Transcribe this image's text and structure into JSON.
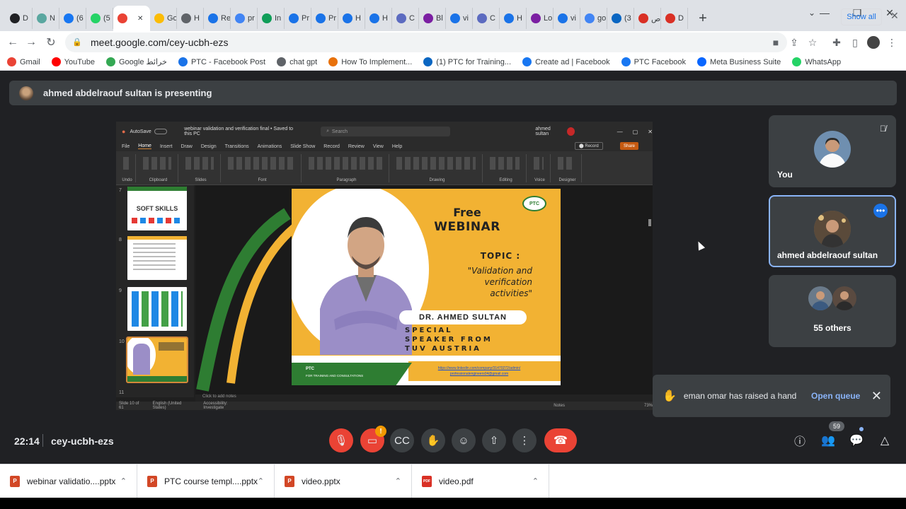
{
  "browser": {
    "tabs": [
      {
        "label": "D",
        "color": "#202124"
      },
      {
        "label": "N",
        "color": "#5aa7a0"
      },
      {
        "label": "(6",
        "color": "#1877f2"
      },
      {
        "label": "(5",
        "color": "#25d366"
      },
      {
        "label": "",
        "color": "#ea4335"
      },
      {
        "label": "Go",
        "color": "#fbbc05"
      },
      {
        "label": "H",
        "color": "#5f6368"
      },
      {
        "label": "Re",
        "color": "#1a73e8"
      },
      {
        "label": "pr",
        "color": "#4285f4"
      },
      {
        "label": "In",
        "color": "#0f9d58"
      },
      {
        "label": "Pr",
        "color": "#1a73e8"
      },
      {
        "label": "Pr",
        "color": "#1a73e8"
      },
      {
        "label": "H",
        "color": "#1a73e8"
      },
      {
        "label": "H",
        "color": "#1a73e8"
      },
      {
        "label": "C",
        "color": "#5c6bc0"
      },
      {
        "label": "Bl",
        "color": "#7b1fa2"
      },
      {
        "label": "vi",
        "color": "#1a73e8"
      },
      {
        "label": "C",
        "color": "#5c6bc0"
      },
      {
        "label": "H",
        "color": "#1a73e8"
      },
      {
        "label": "Lo",
        "color": "#7b1fa2"
      },
      {
        "label": "vi",
        "color": "#1a73e8"
      },
      {
        "label": "go",
        "color": "#4285f4"
      },
      {
        "label": "(3",
        "color": "#0a66c2"
      },
      {
        "label": "ص",
        "color": "#d93025"
      },
      {
        "label": "D",
        "color": "#d93025"
      }
    ],
    "url": "meet.google.com/cey-ucbh-ezs",
    "bookmarks": [
      {
        "label": "Gmail",
        "color": "#ea4335"
      },
      {
        "label": "YouTube",
        "color": "#ff0000"
      },
      {
        "label": "Google خرائط",
        "color": "#34a853"
      },
      {
        "label": "PTC - Facebook Post",
        "color": "#1a73e8"
      },
      {
        "label": "chat gpt",
        "color": "#5f6368"
      },
      {
        "label": "How To Implement...",
        "color": "#e8710a"
      },
      {
        "label": "(1) PTC for Training...",
        "color": "#0a66c2"
      },
      {
        "label": "Create ad | Facebook",
        "color": "#1877f2"
      },
      {
        "label": "PTC Facebook",
        "color": "#1877f2"
      },
      {
        "label": "Meta Business Suite",
        "color": "#0866ff"
      },
      {
        "label": "WhatsApp",
        "color": "#25d366"
      }
    ]
  },
  "meet": {
    "presenting_text": "ahmed abdelraouf sultan is presenting",
    "participants": {
      "you_label": "You",
      "active_name": "ahmed abdelraouf sultan",
      "others_label": "55 others",
      "count_badge": "59"
    },
    "toast": {
      "text": "eman omar has raised a hand",
      "action": "Open queue"
    },
    "time": "22:14",
    "meeting_code": "cey-ucbh-ezs",
    "camera_badge": "!"
  },
  "presentation": {
    "file_title": "webinar validation and verification final • Saved to this PC",
    "search_placeholder": "Search",
    "user": "ahmed sultan",
    "ribbon_tabs": [
      "File",
      "Home",
      "Insert",
      "Draw",
      "Design",
      "Transitions",
      "Animations",
      "Slide Show",
      "Record",
      "Review",
      "View",
      "Help"
    ],
    "ribbon_groups": [
      "Undo",
      "Clipboard",
      "Slides",
      "Font",
      "Paragraph",
      "Drawing",
      "Editing",
      "Voice",
      "Designer"
    ],
    "record_label": "Record",
    "share_label": "Share",
    "thumb_numbers": [
      "7",
      "8",
      "9",
      "10",
      "11"
    ],
    "thumb_7_text": "SOFT SKILLS",
    "notes_placeholder": "Click to add notes",
    "status_slide": "Slide 10 of 61",
    "status_lang": "English (United States)",
    "status_access": "Accessibility: Investigate",
    "status_notes": "Notes",
    "zoom": "73%",
    "slide": {
      "free": "Free",
      "webinar": "WEBINAR",
      "topic": "TOPIC :",
      "quote_lines": [
        "\"Validation and",
        "verification",
        "activities\""
      ],
      "name": "DR. AHMED SULTAN",
      "special_lines": [
        "SPECIAL",
        "SPEAKER   FROM",
        "TUV AUSTRIA"
      ],
      "logo": "PTC",
      "footer_brand": "PTC",
      "footer_sub": "FOR TRAINING AND CONSULTATIONS",
      "link1": "https://www.linkedin.com/company/31470272/admin/",
      "link2": "professionalengineers04@gmail.com"
    }
  },
  "downloads": [
    {
      "name": "webinar validatio....pptx",
      "color": "#d24726",
      "type": "P"
    },
    {
      "name": "PTC course templ....pptx",
      "color": "#d24726",
      "type": "P"
    },
    {
      "name": "video.pptx",
      "color": "#d24726",
      "type": "P"
    },
    {
      "name": "video.pdf",
      "color": "#d93025",
      "type": "PDF"
    }
  ],
  "downloads_show_all": "Show all"
}
